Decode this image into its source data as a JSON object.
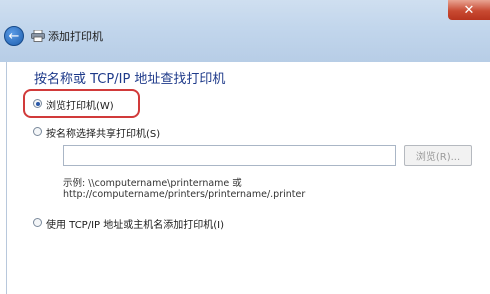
{
  "window": {
    "title": "添加打印机",
    "close_label": "✕"
  },
  "page": {
    "heading": "按名称或 TCP/IP 地址查找打印机"
  },
  "options": {
    "browse_printer_label": "浏览打印机(W)",
    "select_shared_label": "按名称选择共享打印机(S)",
    "tcp_ip_label": "使用 TCP/IP 地址或主机名添加打印机(I)",
    "selected": "browse_printer"
  },
  "shared_printer": {
    "input_value": "",
    "browse_button_label": "浏览(R)...",
    "example_line1": "示例: \\\\computername\\printername 或",
    "example_line2": "http://computername/printers/printername/.printer"
  },
  "colors": {
    "title_bar": "#c2d6ec",
    "heading_text": "#1e3a8a",
    "highlight_border": "#d13a3a",
    "close_button": "#c84a32"
  },
  "icons": {
    "back": "back-arrow-icon",
    "printer": "printer-icon",
    "close": "close-icon"
  }
}
